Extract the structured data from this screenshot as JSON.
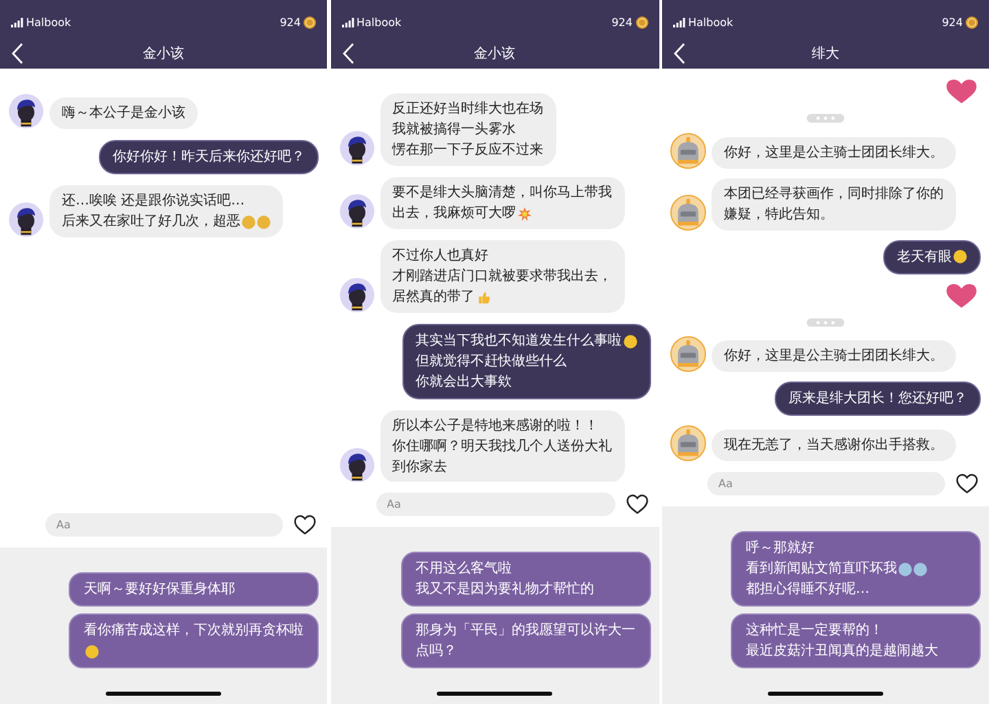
{
  "panels": [
    {
      "status": {
        "carrier": "Halbook",
        "coins": "924"
      },
      "title": "金小该",
      "avatar": {
        "kind": "human"
      },
      "messages": [
        {
          "kind": "incoming",
          "lines": [
            {
              "text": "嗨～本公子是金小该"
            }
          ]
        },
        {
          "kind": "outgoing",
          "lines": [
            {
              "text": "你好你好！昨天后来你还好吧？"
            }
          ]
        },
        {
          "kind": "incoming",
          "lines": [
            {
              "text": "还…唉唉 还是跟你说实话吧…"
            },
            {
              "text": "后来又在家吐了好几次，超恶",
              "emojis": [
                {
                  "kind": "sick"
                },
                {
                  "kind": "sick"
                }
              ]
            }
          ]
        }
      ],
      "input": {
        "placeholder": "Aa"
      },
      "choices": [
        {
          "lines": [
            {
              "text": "天啊～要好好保重身体耶"
            }
          ]
        },
        {
          "lines": [
            {
              "text": "看你痛苦成这样，下次就别再贪杯啦"
            },
            {
              "emojis": [
                {
                  "kind": "grin"
                }
              ]
            }
          ]
        }
      ]
    },
    {
      "status": {
        "carrier": "Halbook",
        "coins": "924"
      },
      "title": "金小该",
      "avatar": {
        "kind": "human"
      },
      "messages": [
        {
          "kind": "incoming",
          "lines": [
            {
              "text": "反正还好当时绯大也在场"
            },
            {
              "text": "我就被搞得一头雾水"
            },
            {
              "text": "愣在那一下子反应不过来"
            }
          ]
        },
        {
          "kind": "incoming",
          "lines": [
            {
              "text": "要不是绯大头脑清楚，叫你马上带我"
            },
            {
              "text": "出去，我麻烦可大啰",
              "emojis": [
                {
                  "kind": "burst"
                }
              ]
            }
          ]
        },
        {
          "kind": "incoming",
          "lines": [
            {
              "text": "不过你人也真好"
            },
            {
              "text": "才刚踏进店门口就被要求带我出去，"
            },
            {
              "text": "居然真的带了",
              "emojis": [
                {
                  "kind": "thumb"
                }
              ]
            }
          ]
        },
        {
          "kind": "outgoing",
          "lines": [
            {
              "text": "其实当下我也不知道发生什么事啦",
              "emojis": [
                {
                  "kind": "sweat"
                }
              ]
            },
            {
              "text": "但就觉得不赶快做些什么"
            },
            {
              "text": "你就会出大事欸"
            }
          ]
        },
        {
          "kind": "incoming",
          "lines": [
            {
              "text": "所以本公子是特地来感谢的啦！！"
            },
            {
              "text": "你住哪啊？明天我找几个人送份大礼"
            },
            {
              "text": "到你家去"
            }
          ]
        }
      ],
      "input": {
        "placeholder": "Aa"
      },
      "choices": [
        {
          "lines": [
            {
              "text": "不用这么客气啦"
            },
            {
              "text": "我又不是因为要礼物才帮忙的"
            }
          ]
        },
        {
          "lines": [
            {
              "text": "那身为「平民」的我愿望可以许大一"
            },
            {
              "text": "点吗？"
            }
          ]
        }
      ]
    },
    {
      "status": {
        "carrier": "Halbook",
        "coins": "924"
      },
      "title": "绯大",
      "avatar": {
        "kind": "robot"
      },
      "messages": [
        {
          "kind": "heart"
        },
        {
          "kind": "typing"
        },
        {
          "kind": "incoming",
          "lines": [
            {
              "text": "你好，这里是公主骑士团团长绯大。"
            }
          ]
        },
        {
          "kind": "incoming",
          "lines": [
            {
              "text": "本团已经寻获画作，同时排除了你的"
            },
            {
              "text": "嫌疑，特此告知。"
            }
          ]
        },
        {
          "kind": "outgoing",
          "lines": [
            {
              "text": "老天有眼",
              "emojis": [
                {
                  "kind": "cry"
                }
              ]
            }
          ]
        },
        {
          "kind": "heart"
        },
        {
          "kind": "typing"
        },
        {
          "kind": "incoming",
          "lines": [
            {
              "text": "你好，这里是公主骑士团团长绯大。"
            }
          ]
        },
        {
          "kind": "outgoing",
          "lines": [
            {
              "text": "原来是绯大团长！您还好吧？"
            }
          ]
        },
        {
          "kind": "incoming",
          "lines": [
            {
              "text": "现在无恙了，当天感谢你出手搭救。"
            }
          ]
        }
      ],
      "input": {
        "placeholder": "Aa"
      },
      "choices": [
        {
          "lines": [
            {
              "text": "呼～那就好"
            },
            {
              "text": "看到新闻贴文简直吓坏我",
              "emojis": [
                {
                  "kind": "scream"
                },
                {
                  "kind": "scream"
                }
              ]
            },
            {
              "text": "都担心得睡不好呢…"
            }
          ]
        },
        {
          "lines": [
            {
              "text": "这种忙是一定要帮的！"
            },
            {
              "text": "最近皮菇汁丑闻真的是越闹越大"
            }
          ]
        }
      ]
    }
  ]
}
